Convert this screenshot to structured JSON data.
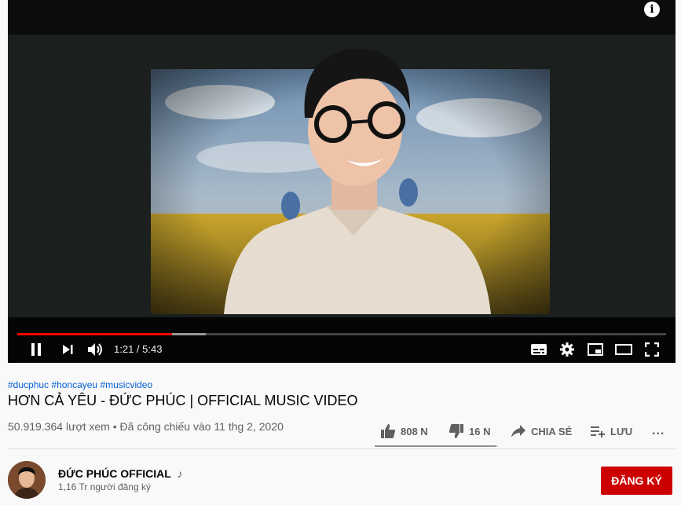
{
  "video": {
    "current_time": "1:21",
    "duration": "5:43",
    "time_display": "1:21 / 5:43",
    "progress_fraction": 0.238,
    "buffered_fraction": 0.291
  },
  "player_icons": {
    "info": "info-icon",
    "pause": "pause-icon",
    "next": "next-icon",
    "volume": "volume-icon",
    "subtitles": "subtitles-icon",
    "settings": "gear-icon",
    "miniplayer": "miniplayer-icon",
    "theater": "theater-icon",
    "fullscreen": "fullscreen-icon"
  },
  "info_glyph": "i",
  "tags": [
    "#ducphuc",
    "#honcayeu",
    "#musicvideo"
  ],
  "title": "HƠN CẢ YÊU - ĐỨC PHÚC | OFFICIAL MUSIC VIDEO",
  "meta": {
    "views": "50.919.364 lượt xem",
    "separator": "•",
    "premiered": "Đã công chiếu vào 11 thg 2, 2020"
  },
  "actions": {
    "likes": "808 N",
    "dislikes": "16 N",
    "share": "CHIA SẺ",
    "save": "LƯU",
    "more": "..."
  },
  "sentiment": {
    "like_fraction": 0.98
  },
  "channel": {
    "name": "ĐỨC PHÚC OFFICIAL",
    "badge": "♪",
    "subscribers": "1,16 Tr người đăng ký",
    "subscribe_label": "ĐĂNG KÝ"
  },
  "colors": {
    "accent": "#ff0000",
    "subscribe": "#cc0000",
    "link": "#065fd4",
    "secondary_text": "#606060"
  }
}
